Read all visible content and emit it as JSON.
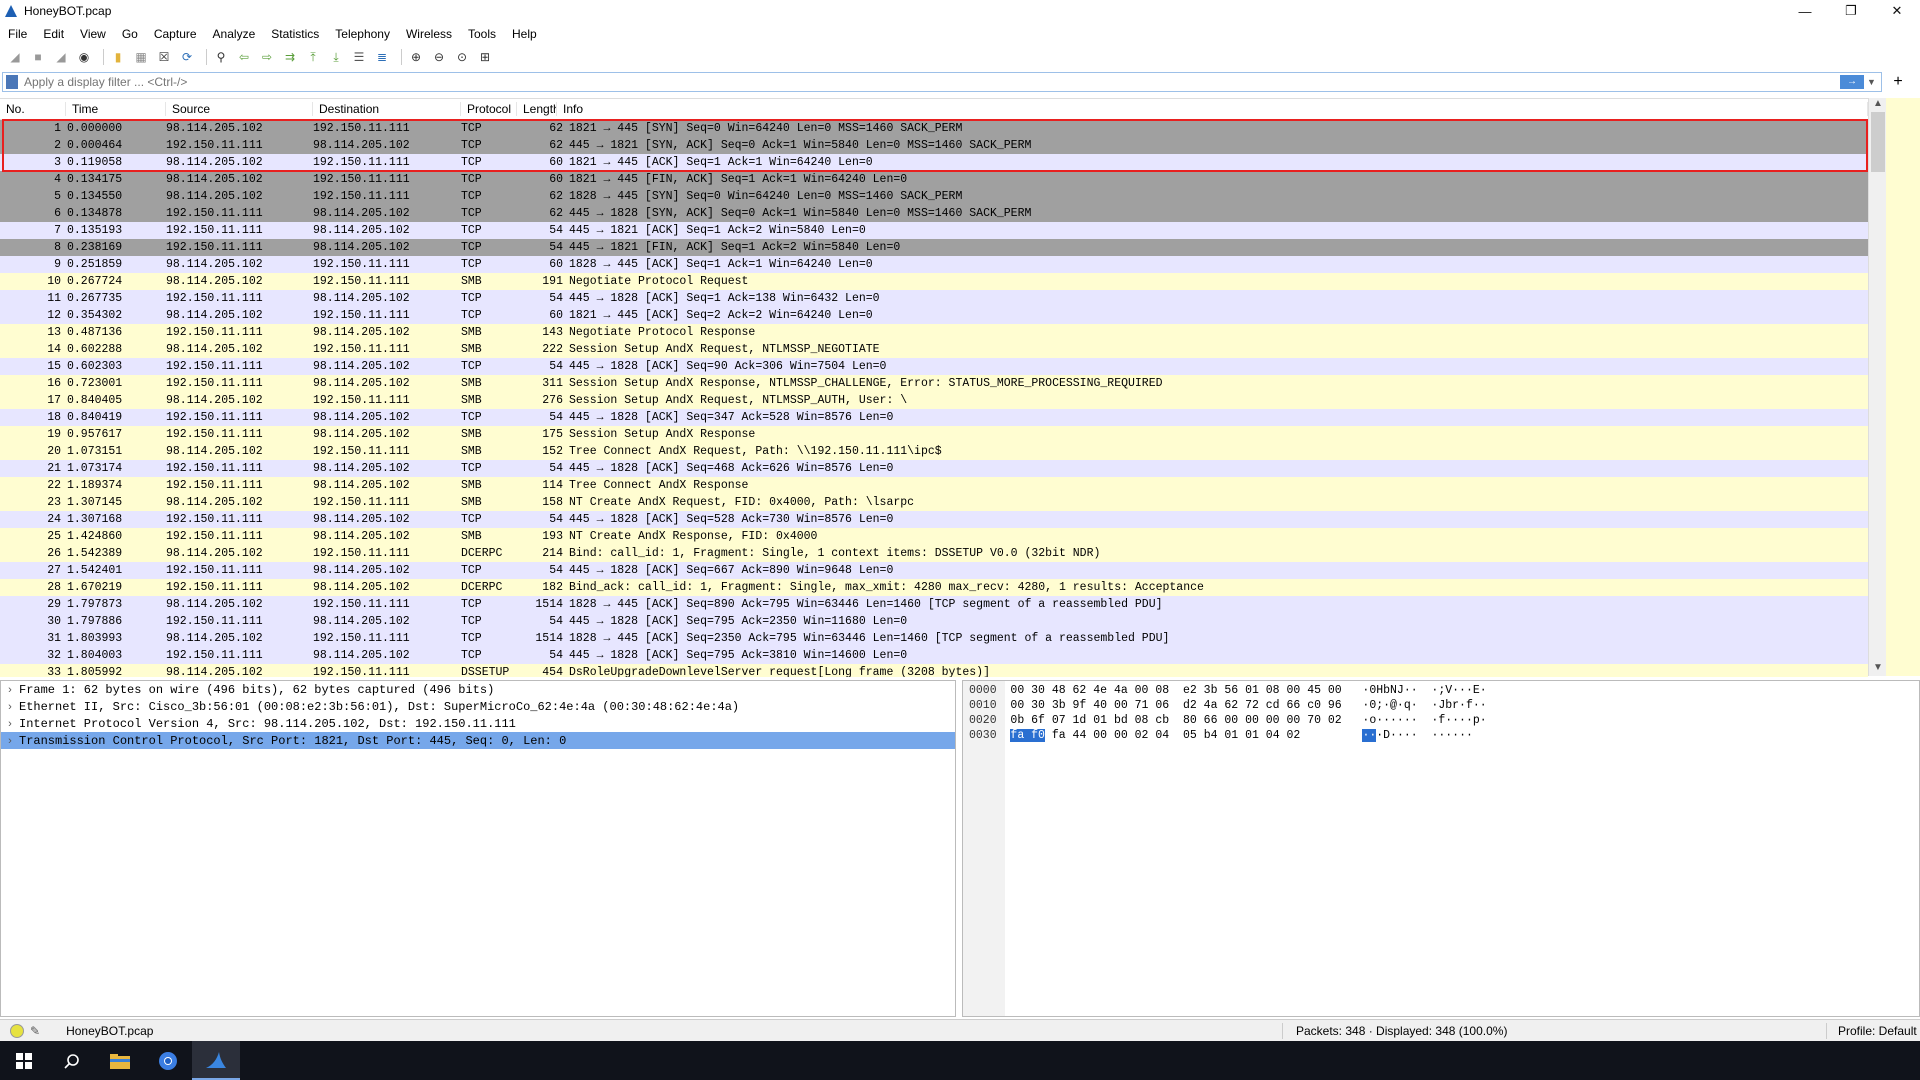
{
  "window": {
    "title": "HoneyBOT.pcap",
    "controls": [
      "—",
      "❐",
      "✕"
    ]
  },
  "menu": [
    "File",
    "Edit",
    "View",
    "Go",
    "Capture",
    "Analyze",
    "Statistics",
    "Telephony",
    "Wireless",
    "Tools",
    "Help"
  ],
  "filter": {
    "placeholder": "Apply a display filter ... <Ctrl-/>",
    "apply_icon": "→",
    "add_label": "+"
  },
  "columns": {
    "no": "No.",
    "time": "Time",
    "source": "Source",
    "destination": "Destination",
    "protocol": "Protocol",
    "length": "Length",
    "info": "Info"
  },
  "packets": [
    {
      "no": "1",
      "time": "0.000000",
      "src": "98.114.205.102",
      "dst": "192.150.11.111",
      "proto": "TCP",
      "len": "62",
      "info": "1821 → 445 [SYN] Seq=0 Win=64240 Len=0 MSS=1460 SACK_PERM",
      "color": "gray"
    },
    {
      "no": "2",
      "time": "0.000464",
      "src": "192.150.11.111",
      "dst": "98.114.205.102",
      "proto": "TCP",
      "len": "62",
      "info": "445 → 1821 [SYN, ACK] Seq=0 Ack=1 Win=5840 Len=0 MSS=1460 SACK_PERM",
      "color": "gray"
    },
    {
      "no": "3",
      "time": "0.119058",
      "src": "98.114.205.102",
      "dst": "192.150.11.111",
      "proto": "TCP",
      "len": "60",
      "info": "1821 → 445 [ACK] Seq=1 Ack=1 Win=64240 Len=0",
      "color": "lav"
    },
    {
      "no": "4",
      "time": "0.134175",
      "src": "98.114.205.102",
      "dst": "192.150.11.111",
      "proto": "TCP",
      "len": "60",
      "info": "1821 → 445 [FIN, ACK] Seq=1 Ack=1 Win=64240 Len=0",
      "color": "gray"
    },
    {
      "no": "5",
      "time": "0.134550",
      "src": "98.114.205.102",
      "dst": "192.150.11.111",
      "proto": "TCP",
      "len": "62",
      "info": "1828 → 445 [SYN] Seq=0 Win=64240 Len=0 MSS=1460 SACK_PERM",
      "color": "gray"
    },
    {
      "no": "6",
      "time": "0.134878",
      "src": "192.150.11.111",
      "dst": "98.114.205.102",
      "proto": "TCP",
      "len": "62",
      "info": "445 → 1828 [SYN, ACK] Seq=0 Ack=1 Win=5840 Len=0 MSS=1460 SACK_PERM",
      "color": "gray"
    },
    {
      "no": "7",
      "time": "0.135193",
      "src": "192.150.11.111",
      "dst": "98.114.205.102",
      "proto": "TCP",
      "len": "54",
      "info": "445 → 1821 [ACK] Seq=1 Ack=2 Win=5840 Len=0",
      "color": "lav"
    },
    {
      "no": "8",
      "time": "0.238169",
      "src": "192.150.11.111",
      "dst": "98.114.205.102",
      "proto": "TCP",
      "len": "54",
      "info": "445 → 1821 [FIN, ACK] Seq=1 Ack=2 Win=5840 Len=0",
      "color": "gray"
    },
    {
      "no": "9",
      "time": "0.251859",
      "src": "98.114.205.102",
      "dst": "192.150.11.111",
      "proto": "TCP",
      "len": "60",
      "info": "1828 → 445 [ACK] Seq=1 Ack=1 Win=64240 Len=0",
      "color": "lav"
    },
    {
      "no": "10",
      "time": "0.267724",
      "src": "98.114.205.102",
      "dst": "192.150.11.111",
      "proto": "SMB",
      "len": "191",
      "info": "Negotiate Protocol Request",
      "color": "yel"
    },
    {
      "no": "11",
      "time": "0.267735",
      "src": "192.150.11.111",
      "dst": "98.114.205.102",
      "proto": "TCP",
      "len": "54",
      "info": "445 → 1828 [ACK] Seq=1 Ack=138 Win=6432 Len=0",
      "color": "lav"
    },
    {
      "no": "12",
      "time": "0.354302",
      "src": "98.114.205.102",
      "dst": "192.150.11.111",
      "proto": "TCP",
      "len": "60",
      "info": "1821 → 445 [ACK] Seq=2 Ack=2 Win=64240 Len=0",
      "color": "lav"
    },
    {
      "no": "13",
      "time": "0.487136",
      "src": "192.150.11.111",
      "dst": "98.114.205.102",
      "proto": "SMB",
      "len": "143",
      "info": "Negotiate Protocol Response",
      "color": "yel"
    },
    {
      "no": "14",
      "time": "0.602288",
      "src": "98.114.205.102",
      "dst": "192.150.11.111",
      "proto": "SMB",
      "len": "222",
      "info": "Session Setup AndX Request, NTLMSSP_NEGOTIATE",
      "color": "yel"
    },
    {
      "no": "15",
      "time": "0.602303",
      "src": "192.150.11.111",
      "dst": "98.114.205.102",
      "proto": "TCP",
      "len": "54",
      "info": "445 → 1828 [ACK] Seq=90 Ack=306 Win=7504 Len=0",
      "color": "lav"
    },
    {
      "no": "16",
      "time": "0.723001",
      "src": "192.150.11.111",
      "dst": "98.114.205.102",
      "proto": "SMB",
      "len": "311",
      "info": "Session Setup AndX Response, NTLMSSP_CHALLENGE, Error: STATUS_MORE_PROCESSING_REQUIRED",
      "color": "yel"
    },
    {
      "no": "17",
      "time": "0.840405",
      "src": "98.114.205.102",
      "dst": "192.150.11.111",
      "proto": "SMB",
      "len": "276",
      "info": "Session Setup AndX Request, NTLMSSP_AUTH, User: \\",
      "color": "yel"
    },
    {
      "no": "18",
      "time": "0.840419",
      "src": "192.150.11.111",
      "dst": "98.114.205.102",
      "proto": "TCP",
      "len": "54",
      "info": "445 → 1828 [ACK] Seq=347 Ack=528 Win=8576 Len=0",
      "color": "lav"
    },
    {
      "no": "19",
      "time": "0.957617",
      "src": "192.150.11.111",
      "dst": "98.114.205.102",
      "proto": "SMB",
      "len": "175",
      "info": "Session Setup AndX Response",
      "color": "yel"
    },
    {
      "no": "20",
      "time": "1.073151",
      "src": "98.114.205.102",
      "dst": "192.150.11.111",
      "proto": "SMB",
      "len": "152",
      "info": "Tree Connect AndX Request, Path: \\\\192.150.11.111\\ipc$",
      "color": "yel"
    },
    {
      "no": "21",
      "time": "1.073174",
      "src": "192.150.11.111",
      "dst": "98.114.205.102",
      "proto": "TCP",
      "len": "54",
      "info": "445 → 1828 [ACK] Seq=468 Ack=626 Win=8576 Len=0",
      "color": "lav"
    },
    {
      "no": "22",
      "time": "1.189374",
      "src": "192.150.11.111",
      "dst": "98.114.205.102",
      "proto": "SMB",
      "len": "114",
      "info": "Tree Connect AndX Response",
      "color": "yel"
    },
    {
      "no": "23",
      "time": "1.307145",
      "src": "98.114.205.102",
      "dst": "192.150.11.111",
      "proto": "SMB",
      "len": "158",
      "info": "NT Create AndX Request, FID: 0x4000, Path: \\lsarpc",
      "color": "yel"
    },
    {
      "no": "24",
      "time": "1.307168",
      "src": "192.150.11.111",
      "dst": "98.114.205.102",
      "proto": "TCP",
      "len": "54",
      "info": "445 → 1828 [ACK] Seq=528 Ack=730 Win=8576 Len=0",
      "color": "lav"
    },
    {
      "no": "25",
      "time": "1.424860",
      "src": "192.150.11.111",
      "dst": "98.114.205.102",
      "proto": "SMB",
      "len": "193",
      "info": "NT Create AndX Response, FID: 0x4000",
      "color": "yel"
    },
    {
      "no": "26",
      "time": "1.542389",
      "src": "98.114.205.102",
      "dst": "192.150.11.111",
      "proto": "DCERPC",
      "len": "214",
      "info": "Bind: call_id: 1, Fragment: Single, 1 context items: DSSETUP V0.0 (32bit NDR)",
      "color": "yel"
    },
    {
      "no": "27",
      "time": "1.542401",
      "src": "192.150.11.111",
      "dst": "98.114.205.102",
      "proto": "TCP",
      "len": "54",
      "info": "445 → 1828 [ACK] Seq=667 Ack=890 Win=9648 Len=0",
      "color": "lav"
    },
    {
      "no": "28",
      "time": "1.670219",
      "src": "192.150.11.111",
      "dst": "98.114.205.102",
      "proto": "DCERPC",
      "len": "182",
      "info": "Bind_ack: call_id: 1, Fragment: Single, max_xmit: 4280 max_recv: 4280, 1 results: Acceptance",
      "color": "yel"
    },
    {
      "no": "29",
      "time": "1.797873",
      "src": "98.114.205.102",
      "dst": "192.150.11.111",
      "proto": "TCP",
      "len": "1514",
      "info": "1828 → 445 [ACK] Seq=890 Ack=795 Win=63446 Len=1460 [TCP segment of a reassembled PDU]",
      "color": "lav"
    },
    {
      "no": "30",
      "time": "1.797886",
      "src": "192.150.11.111",
      "dst": "98.114.205.102",
      "proto": "TCP",
      "len": "54",
      "info": "445 → 1828 [ACK] Seq=795 Ack=2350 Win=11680 Len=0",
      "color": "lav"
    },
    {
      "no": "31",
      "time": "1.803993",
      "src": "98.114.205.102",
      "dst": "192.150.11.111",
      "proto": "TCP",
      "len": "1514",
      "info": "1828 → 445 [ACK] Seq=2350 Ack=795 Win=63446 Len=1460 [TCP segment of a reassembled PDU]",
      "color": "lav"
    },
    {
      "no": "32",
      "time": "1.804003",
      "src": "192.150.11.111",
      "dst": "98.114.205.102",
      "proto": "TCP",
      "len": "54",
      "info": "445 → 1828 [ACK] Seq=795 Ack=3810 Win=14600 Len=0",
      "color": "lav"
    },
    {
      "no": "33",
      "time": "1.805992",
      "src": "98.114.205.102",
      "dst": "192.150.11.111",
      "proto": "DSSETUP",
      "len": "454",
      "info": "DsRoleUpgradeDownlevelServer request[Long frame (3208 bytes)]",
      "color": "yel"
    }
  ],
  "details": [
    {
      "text": "Frame 1: 62 bytes on wire (496 bits), 62 bytes captured (496 bits)",
      "selected": false
    },
    {
      "text": "Ethernet II, Src: Cisco_3b:56:01 (00:08:e2:3b:56:01), Dst: SuperMicroCo_62:4e:4a (00:30:48:62:4e:4a)",
      "selected": false
    },
    {
      "text": "Internet Protocol Version 4, Src: 98.114.205.102, Dst: 192.150.11.111",
      "selected": false
    },
    {
      "text": "Transmission Control Protocol, Src Port: 1821, Dst Port: 445, Seq: 0, Len: 0",
      "selected": true
    }
  ],
  "bytes": [
    {
      "offset": "0000",
      "hex1": "00 30 48 62 4e 4a 00 08",
      "hex2": "e2 3b 56 01 08 00 45 00",
      "ascii": "·0HbNJ··  ·;V···E·"
    },
    {
      "offset": "0010",
      "hex1": "00 30 3b 9f 40 00 71 06",
      "hex2": "d2 4a 62 72 cd 66 c0 96",
      "ascii": "·0;·@·q·  ·Jbr·f··"
    },
    {
      "offset": "0020",
      "hex1": "0b 6f 07 1d 01 bd 08 cb",
      "hex2": "80 66 00 00 00 00 70 02",
      "ascii": "·o······  ·f····p·"
    },
    {
      "offset": "0030",
      "hex_hl": "fa f0",
      "hex_rest": "fa 44 00 00 02 04",
      "hex2": "05 b4 01 01 04 02",
      "ascii_hl": "··",
      "ascii_rest": "·D····  ······"
    }
  ],
  "status": {
    "filename": "HoneyBOT.pcap",
    "packets": "Packets: 348 · Displayed: 348 (100.0%)",
    "profile": "Profile: Default"
  }
}
